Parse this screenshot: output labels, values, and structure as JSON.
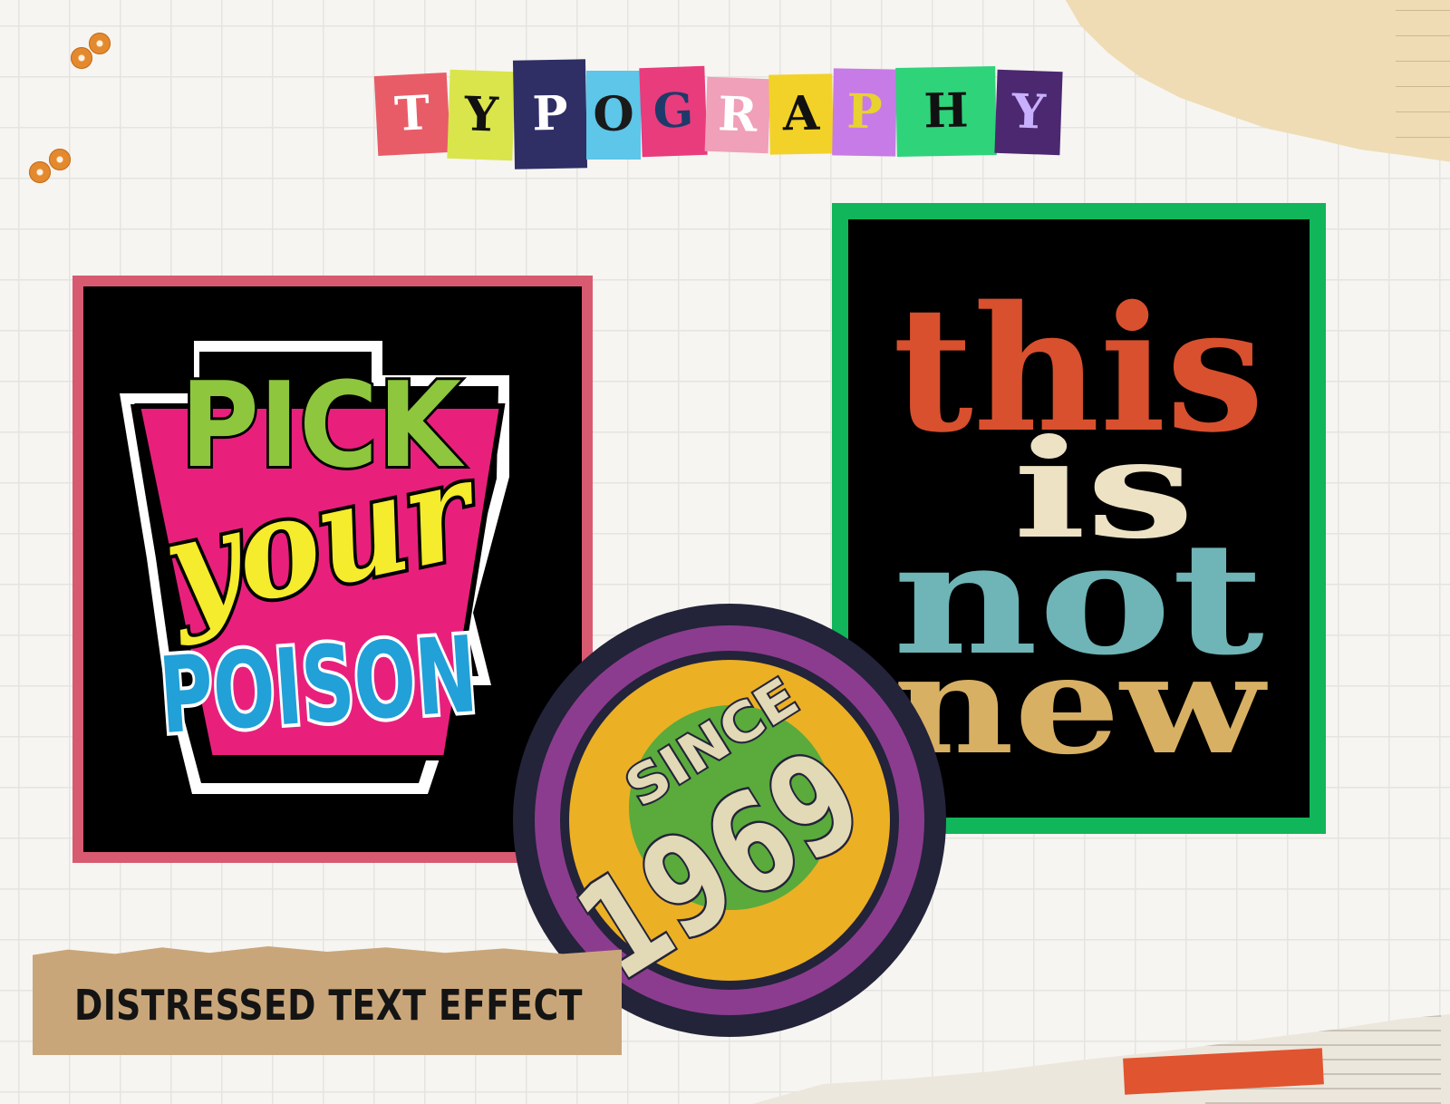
{
  "title": {
    "letters": [
      {
        "char": "T",
        "bg": "#e85c68",
        "fg": "#ffffff"
      },
      {
        "char": "Y",
        "bg": "#d9e54a",
        "fg": "#111111"
      },
      {
        "char": "P",
        "bg": "#2f2f66",
        "fg": "#ffffff"
      },
      {
        "char": "O",
        "bg": "#5ec6e8",
        "fg": "#1a1a1a"
      },
      {
        "char": "G",
        "bg": "#e83c7c",
        "fg": "#1d3a6a"
      },
      {
        "char": "R",
        "bg": "#f0a0b8",
        "fg": "#ffffff"
      },
      {
        "char": "A",
        "bg": "#f2d228",
        "fg": "#111111"
      },
      {
        "char": "P",
        "bg": "#c77be6",
        "fg": "#e8d230"
      },
      {
        "char": "H",
        "bg": "#2fd37a",
        "fg": "#111111"
      },
      {
        "char": "Y",
        "bg": "#4b2870",
        "fg": "#c9b0ff"
      }
    ]
  },
  "poster_left": {
    "line1": "PICK",
    "line2": "your",
    "line3": "POISON",
    "colors": {
      "frame": "#d85a70",
      "pick": "#8ec63e",
      "your": "#f4ec2c",
      "poison": "#22a0d8",
      "accent": "#e8207c"
    }
  },
  "poster_right": {
    "line1": "this",
    "line2": "is",
    "line3": "not",
    "line4": "new",
    "colors": {
      "frame": "#11b55a",
      "this": "#d8502e",
      "is": "#ede2c4",
      "not": "#6fb4b6",
      "new": "#d8b064"
    }
  },
  "badge": {
    "top_text": "SINCE",
    "year": "1969",
    "colors": {
      "outer": "#23233a",
      "ring": "#8c3c8e",
      "fill": "#ecb024",
      "center": "#5aaa3c",
      "text": "#e2d9b6"
    }
  },
  "caption": "DISTRESSED TEXT EFFECT",
  "decor": {
    "sequin_icon": "sequin-icon",
    "torn_paper": "torn-paper",
    "tape": "masking-tape"
  }
}
